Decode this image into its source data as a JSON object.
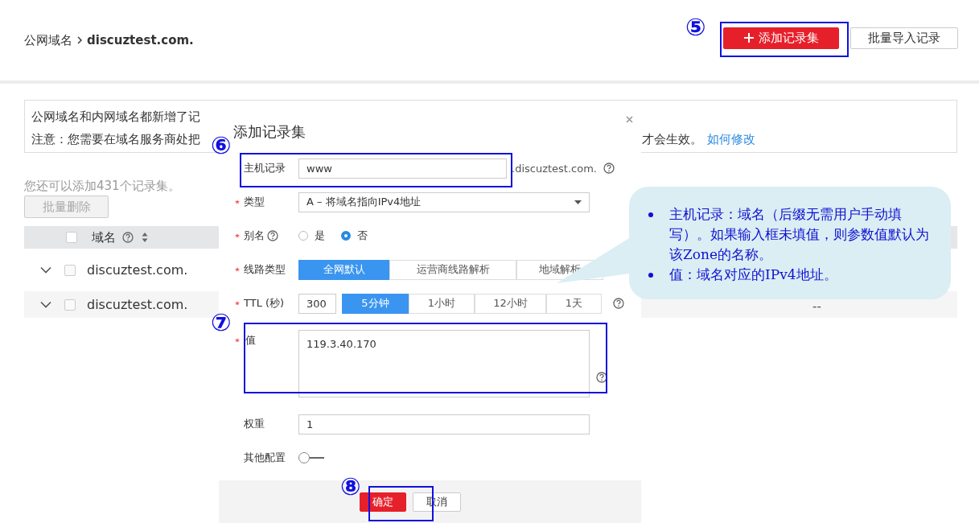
{
  "breadcrumb": {
    "parent": "公网域名",
    "current": "discuztest.com."
  },
  "header_buttons": [
    {
      "label": "添加记录集",
      "kind": "primary"
    },
    {
      "label": "批量导入记录",
      "kind": "default"
    }
  ],
  "notice": {
    "line_1": "公网域名和内网域名都新增了记",
    "line_2": "注意：您需要在域名服务商处把",
    "line_2_tail": "才会生效。",
    "link": "如何修改"
  },
  "quota_text": "您还可以添加431个记录集。",
  "batch_delete": {
    "label": "批量删除",
    "disabled": true
  },
  "table": {
    "header_checked": false,
    "columns": [
      {
        "label": "域名"
      }
    ],
    "rows": [
      {
        "domain": "discuztest.com.",
        "checked": false
      },
      {
        "domain": "discuztest.com.",
        "checked": false
      }
    ],
    "visible_row_part": {
      "column_2": "--"
    }
  },
  "dialog": {
    "title": "添加记录集",
    "fields": [
      {
        "kind": "text",
        "label": "主机记录",
        "required": false,
        "value": "www",
        "suffix": ".discuztest.com.",
        "help": true
      },
      {
        "kind": "select",
        "label": "类型",
        "required": true,
        "value": "A – 将域名指向IPv4地址"
      },
      {
        "kind": "radio",
        "label": "别名",
        "required": true,
        "help": true,
        "options": [
          {
            "label": "是",
            "selected": false
          },
          {
            "label": "否",
            "selected": true
          }
        ]
      },
      {
        "kind": "segments",
        "label": "线路类型",
        "required": true,
        "options": [
          {
            "label": "全网默认",
            "selected": true
          },
          {
            "label": "运营商线路解析",
            "selected": false
          },
          {
            "label": "地域解析",
            "selected": false
          }
        ]
      },
      {
        "kind": "ttl",
        "label": "TTL (秒)",
        "required": true,
        "value": "300",
        "help": true,
        "options": [
          {
            "label": "5分钟",
            "selected": true
          },
          {
            "label": "1小时",
            "selected": false
          },
          {
            "label": "12小时",
            "selected": false
          },
          {
            "label": "1天",
            "selected": false
          }
        ]
      },
      {
        "kind": "textarea",
        "label": "值",
        "required": true,
        "value": "119.3.40.170",
        "help": true
      },
      {
        "kind": "text",
        "label": "权重",
        "required": false,
        "value": "1"
      },
      {
        "kind": "toggle",
        "label": "其他配置",
        "required": false,
        "on": false
      }
    ],
    "buttons": [
      {
        "label": "确定",
        "kind": "primary"
      },
      {
        "label": "取消",
        "kind": "default"
      }
    ]
  },
  "annotations": [
    {
      "number": "⑤"
    },
    {
      "number": "⑥"
    },
    {
      "number": "⑦"
    },
    {
      "number": "⑧"
    }
  ],
  "callout": {
    "items": [
      "主机记录：域名（后缀无需用户手动填写）。如果输入框未填值，则参数值默认为该Zone的名称。",
      "值：域名对应的IPv4地址。"
    ]
  }
}
